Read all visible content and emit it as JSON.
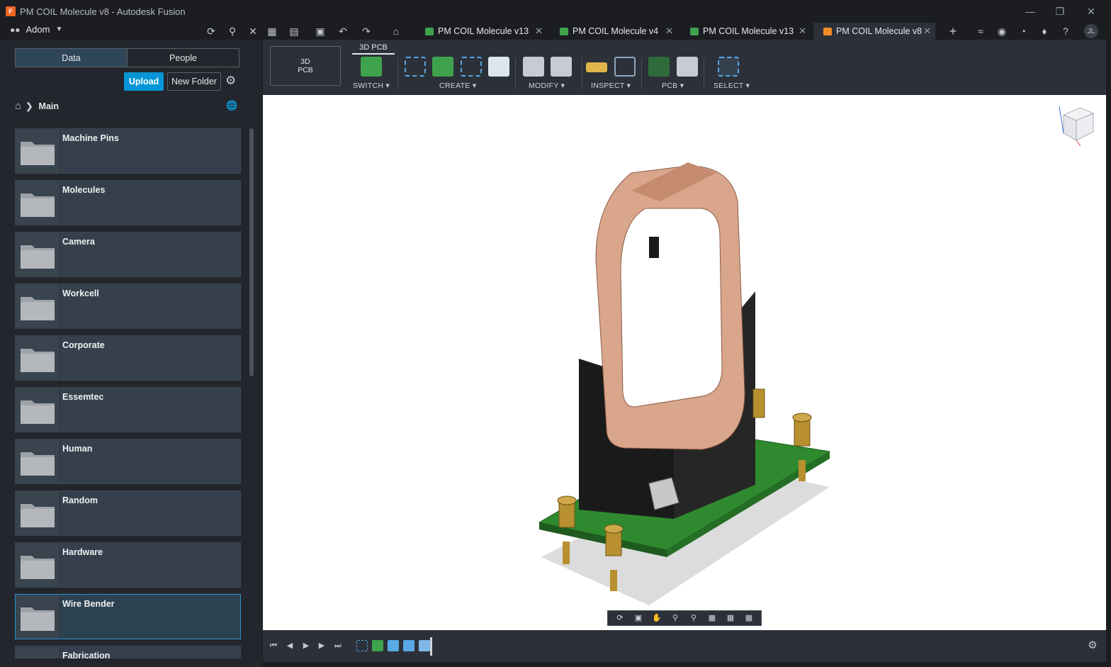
{
  "window": {
    "title": "PM COIL Molecule v8 - Autodesk Fusion",
    "logo_letter": "F"
  },
  "topbar": {
    "team_name": "Adom",
    "user_initials": "JL",
    "tabs": [
      {
        "label": "PM COIL Molecule v13",
        "icon_color": "#3fa34d",
        "active": false
      },
      {
        "label": "PM COIL Molecule v4",
        "icon_color": "#3fa34d",
        "active": false
      },
      {
        "label": "PM COIL Molecule v13",
        "icon_color": "#3fa34d",
        "active": false
      },
      {
        "label": "PM COIL Molecule v8",
        "icon_color": "#f28c28",
        "active": true
      }
    ]
  },
  "data_panel": {
    "tabs": {
      "data": "Data",
      "people": "People"
    },
    "upload_label": "Upload",
    "new_folder_label": "New Folder",
    "breadcrumb": "Main",
    "folders": [
      "Machine Pins",
      "Molecules",
      "Camera",
      "Workcell",
      "Corporate",
      "Essemtec",
      "Human",
      "Random",
      "Hardware",
      "Wire Bender",
      "Fabrication"
    ],
    "selected_folder": "Wire Bender"
  },
  "toolbar": {
    "workspace_line1": "3D",
    "workspace_line2": "PCB",
    "active_tab": "3D PCB",
    "groups": [
      "SWITCH",
      "CREATE",
      "MODIFY",
      "INSPECT",
      "PCB",
      "SELECT"
    ]
  },
  "colors": {
    "accent": "#0696d7",
    "pcb_green": "#2f8a2f",
    "coil_copper": "#d9a68c",
    "housing_black": "#1e1e1e",
    "brass": "#b8902f"
  }
}
